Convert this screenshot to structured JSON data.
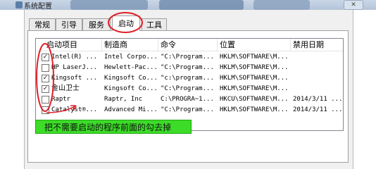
{
  "window": {
    "title": "系统配置",
    "close_label": "✕"
  },
  "tabs": [
    {
      "label": "常规"
    },
    {
      "label": "引导"
    },
    {
      "label": "服务"
    },
    {
      "label": "启动"
    },
    {
      "label": "工具"
    }
  ],
  "active_tab": "启动",
  "columns": [
    "启动项目",
    "制造商",
    "命令",
    "位置",
    "禁用日期"
  ],
  "rows": [
    {
      "checked": true,
      "item": "Intel(R) ...",
      "maker": "Intel Corpo...",
      "command": "\"C:\\Program...",
      "location": "HKLM\\SOFTWARE\\M...",
      "disabled": ""
    },
    {
      "checked": false,
      "item": "HP LaserJ...",
      "maker": "Hewlett-Pac...",
      "command": "\"C:\\Program...",
      "location": "HKLM\\SOFTWARE\\M...",
      "disabled": ""
    },
    {
      "checked": true,
      "item": "Kingsoft ...",
      "maker": "Kingsoft Co...",
      "command": "\"c:\\program...",
      "location": "HKLM\\SOFTWARE\\M...",
      "disabled": ""
    },
    {
      "checked": true,
      "item": "金山卫士",
      "maker": "Kingsoft Co...",
      "command": "\"C:\\Program...",
      "location": "HKLM\\SOFTWARE\\M...",
      "disabled": ""
    },
    {
      "checked": false,
      "item": "Raptr",
      "maker": "Raptr, Inc",
      "command": "C:\\PROGRA~1...",
      "location": "HKCU\\SOFTWARE\\M...",
      "disabled": "2014/3/11 ..."
    },
    {
      "checked": false,
      "item": "Catalyst®...",
      "maker": "Advanced Mi...",
      "command": "\"C:\\Program...",
      "location": "HKLM\\SOFTWARE\\M...",
      "disabled": "2014/3/11 ..."
    }
  ],
  "annotation": {
    "text": "把不需要启动的程序前面的勾去掉",
    "color": "#3cdc28"
  },
  "colors": {
    "highlight": "#e0202a",
    "annotation": "#3cdc28"
  }
}
